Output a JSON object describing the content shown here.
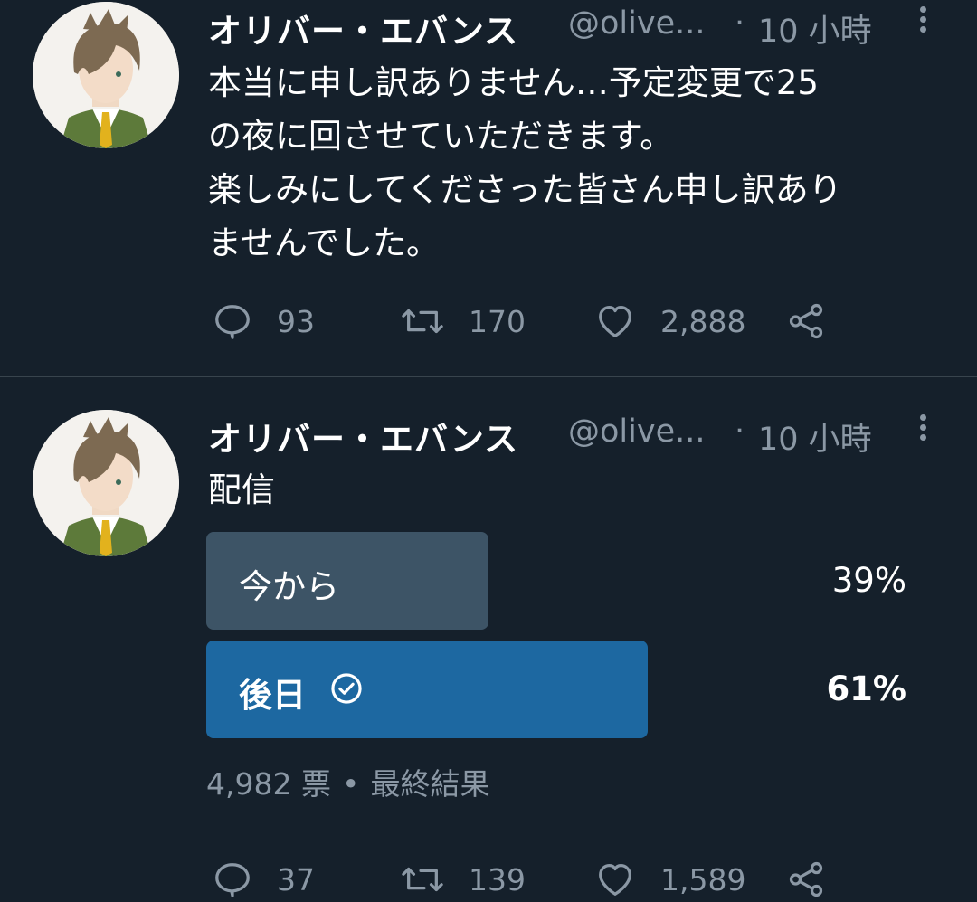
{
  "theme": {
    "background": "#15202b",
    "text_primary": "#ffffff",
    "text_secondary": "#8b98a5",
    "divider": "#38444d",
    "poll_winner": "#1d68a1",
    "poll_loser": "#3d5466"
  },
  "tweets": [
    {
      "author_name": "オリバー・エバンス",
      "handle": "@olive...",
      "time_separator": "·",
      "time": "10 小時",
      "body_lines": [
        "本当に申し訳ありません…予定変更で25",
        "の夜に回させていただきます。",
        "楽しみにしてくださった皆さん申し訳あり",
        "ませんでした。"
      ],
      "replies": "93",
      "retweets": "170",
      "likes": "2,888",
      "icons": {
        "avatar": "avatar-icon",
        "more": "more-vertical-icon",
        "reply": "reply-icon",
        "retweet": "retweet-icon",
        "like": "heart-icon",
        "share": "share-icon"
      }
    },
    {
      "author_name": "オリバー・エバンス",
      "handle": "@olive...",
      "time_separator": "·",
      "time": "10 小時",
      "body_lines": [
        "配信"
      ],
      "poll": {
        "options": [
          {
            "label": "今から",
            "percent_text": "39%",
            "percent": 39,
            "winner": false
          },
          {
            "label": "後日",
            "percent_text": "61%",
            "percent": 61,
            "winner": true
          }
        ],
        "votes": "4,982 票",
        "separator": "•",
        "status": "最終結果"
      },
      "replies": "37",
      "retweets": "139",
      "likes": "1,589",
      "icons": {
        "avatar": "avatar-icon",
        "more": "more-vertical-icon",
        "reply": "reply-icon",
        "retweet": "retweet-icon",
        "like": "heart-icon",
        "share": "share-icon",
        "check": "check-circle-icon"
      }
    }
  ]
}
